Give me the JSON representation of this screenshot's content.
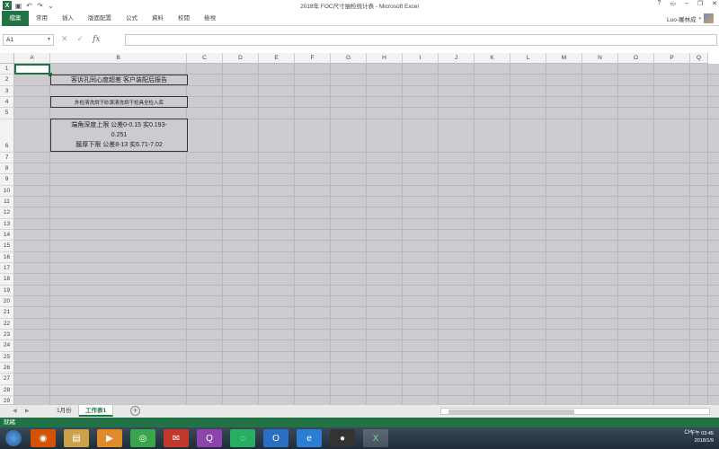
{
  "window": {
    "title": "2018年 FOC尺寸抽检统计表 - Microsoft Excel",
    "controls": [
      "?",
      "▭",
      "–",
      "❐",
      "✕"
    ]
  },
  "quick_access": [
    "save-icon",
    "undo-icon",
    "redo-icon",
    "customize-icon"
  ],
  "ribbon": {
    "tabs": [
      "檔案",
      "常用",
      "插入",
      "版面配置",
      "公式",
      "資料",
      "校閱",
      "檢視"
    ],
    "user_name": "Luo-羅林成"
  },
  "formula_bar": {
    "name_box": "A1",
    "cancel": "✕",
    "enter": "✓",
    "fx": "fx",
    "value": ""
  },
  "grid": {
    "columns": [
      "A",
      "B",
      "C",
      "D",
      "E",
      "F",
      "G",
      "H",
      "I",
      "J",
      "K",
      "L",
      "M",
      "N",
      "O",
      "P",
      "Q"
    ],
    "rows": [
      "1",
      "2",
      "3",
      "4",
      "5",
      "6",
      "7",
      "8",
      "9",
      "10",
      "11",
      "12",
      "13",
      "14",
      "15",
      "16",
      "17",
      "18",
      "19",
      "20",
      "21",
      "22",
      "23",
      "24",
      "25",
      "26",
      "27",
      "28",
      "29"
    ],
    "cells": {
      "B2": "客诉孔同心度超差 客户装配后报告",
      "B4": "外检清洗烘干砂滚清洗烘干检具全检入库",
      "B6_line1": "端角深度上限 公差0-0.15  实0.193-",
      "B6_line2": "0.251",
      "B6_line3": "膜厚下限 公差8-13  实6.71-7.02"
    }
  },
  "sheets": {
    "tabs": [
      "1月份",
      "工作表1"
    ],
    "active": "工作表1",
    "add_label": "+"
  },
  "status": {
    "text": "就緒"
  },
  "taskbar": {
    "apps": [
      "firefox-icon",
      "folder-icon",
      "media-icon",
      "browser-icon",
      "foxmail-icon",
      "qq-icon",
      "wechat-icon",
      "outlook-icon",
      "ie-icon",
      "camera-icon",
      "excel-icon"
    ],
    "tray_lang": "CH",
    "time": "下午 03:45",
    "date": "2018/1/9"
  }
}
